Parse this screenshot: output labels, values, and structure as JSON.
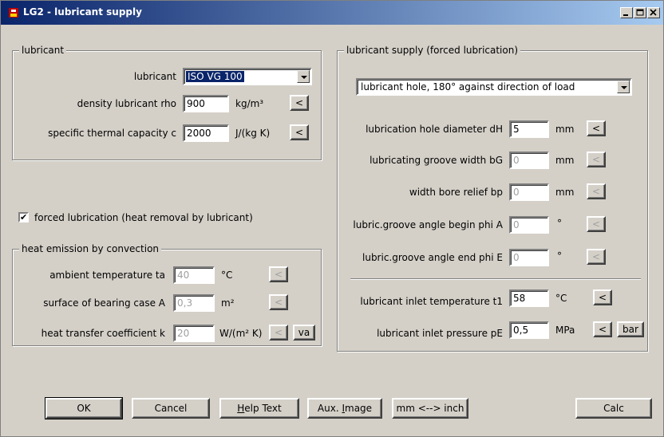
{
  "window": {
    "title": "LG2 - lubricant supply"
  },
  "lubricant_group": {
    "title": "lubricant",
    "lubricant_label": "lubricant",
    "lubricant_value": "ISO VG 100",
    "density_label": "density lubricant rho",
    "density_value": "900",
    "density_unit": "kg/m³",
    "capacity_label": "specific thermal capacity c",
    "capacity_value": "2000",
    "capacity_unit": "J/(kg K)",
    "arrow_label": "<"
  },
  "forced": {
    "label": "forced lubrication (heat removal by lubricant)",
    "checked": "✔"
  },
  "convection_group": {
    "title": "heat emission by convection",
    "ambient_label": "ambient temperature ta",
    "ambient_value": "40",
    "ambient_unit": "°C",
    "surface_label": "surface of bearing case A",
    "surface_value": "0,3",
    "surface_unit": "m²",
    "coeff_label": "heat transfer coefficient k",
    "coeff_value": "20",
    "coeff_unit": "W/(m² K)",
    "va_label": "va",
    "arrow_label": "<"
  },
  "supply_group": {
    "title": "lubricant supply (forced lubrication)",
    "mode_value": "lubricant hole, 180° against direction of load",
    "hole_label": "lubrication hole diameter dH",
    "hole_value": "5",
    "hole_unit": "mm",
    "groove_width_label": "lubricating groove width bG",
    "groove_width_value": "0",
    "groove_width_unit": "mm",
    "relief_label": "width bore relief bp",
    "relief_value": "0",
    "relief_unit": "mm",
    "angle_begin_label": "lubric.groove angle begin phi A",
    "angle_begin_value": "0",
    "angle_begin_unit": "°",
    "angle_end_label": "lubric.groove angle end phi E",
    "angle_end_value": "0",
    "angle_end_unit": "°",
    "inlet_temp_label": "lubricant inlet temperature t1",
    "inlet_temp_value": "58",
    "inlet_temp_unit": "°C",
    "inlet_press_label": "lubricant inlet pressure pE",
    "inlet_press_value": "0,5",
    "inlet_press_unit": "MPa",
    "bar_label": "bar",
    "arrow_label": "<"
  },
  "buttons": {
    "ok": "OK",
    "cancel": "Cancel",
    "help_rest": "elp Text",
    "help_u": "H",
    "aux_pre": "Aux. ",
    "aux_u": "I",
    "aux_rest": "mage",
    "units": "mm <--> inch",
    "calc": "Calc"
  }
}
